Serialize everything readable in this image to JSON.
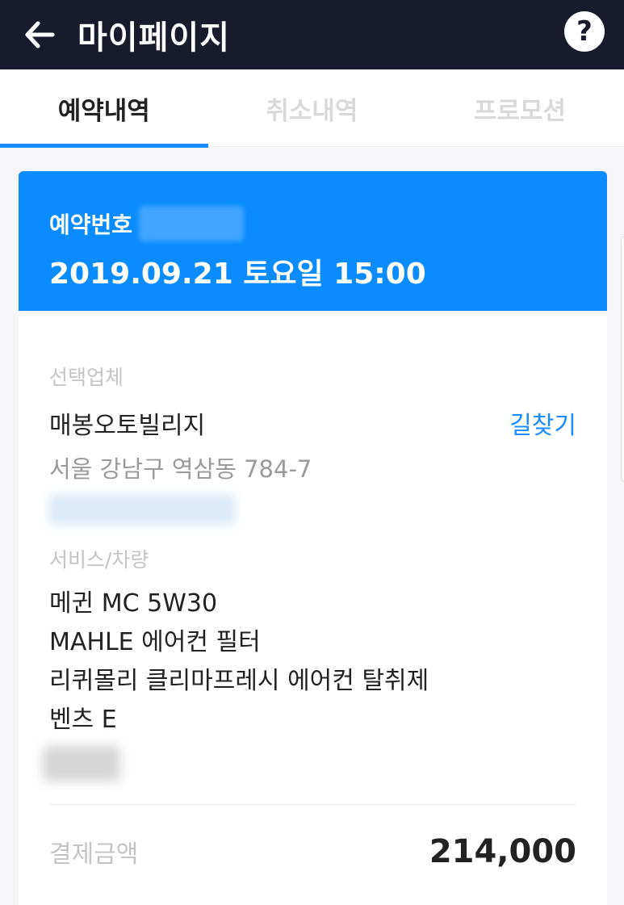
{
  "header": {
    "title": "마이페이지",
    "help_glyph": "?"
  },
  "tabs": [
    {
      "label": "예약내역",
      "active": true
    },
    {
      "label": "취소내역",
      "active": false
    },
    {
      "label": "프로모션",
      "active": false
    }
  ],
  "reservation": {
    "number_label": "예약번호",
    "datetime": "2019.09.21 토요일 15:00"
  },
  "shop": {
    "section_label": "선택업체",
    "name": "매봉오토빌리지",
    "address": "서울 강남구 역삼동 784-7",
    "route_link": "길찾기"
  },
  "service": {
    "section_label": "서비스/차량",
    "items": [
      "메귄 MC 5W30",
      "MAHLE 에어컨 필터",
      "리퀴몰리 클리마프레시 에어컨 탈취제",
      "벤츠 E"
    ]
  },
  "payment": {
    "label": "결제금액",
    "amount": "214,000"
  },
  "colors": {
    "topbar": "#181b2c",
    "accent": "#0a8cff",
    "link": "#1a8cff"
  }
}
